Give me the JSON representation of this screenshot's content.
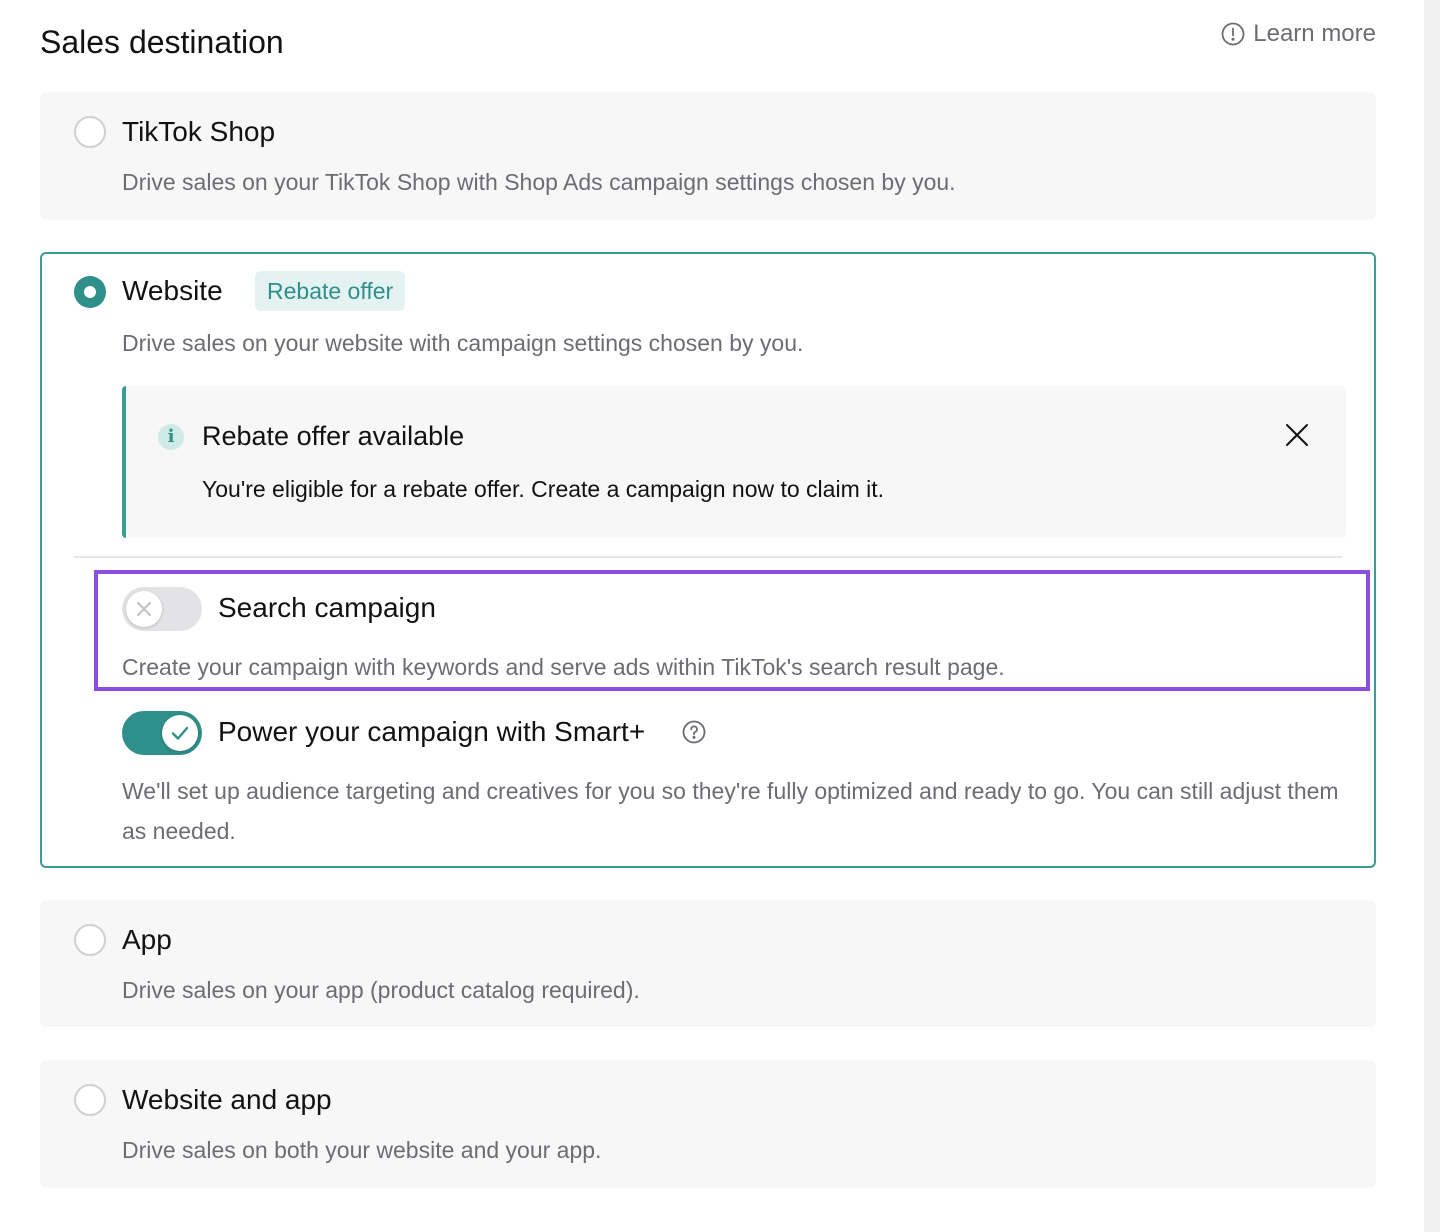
{
  "header": {
    "title": "Sales destination",
    "learn_more": "Learn more"
  },
  "options": [
    {
      "title": "TikTok Shop",
      "description": "Drive sales on your TikTok Shop with Shop Ads campaign settings chosen by you.",
      "selected": false
    },
    {
      "title": "Website",
      "badge": "Rebate offer",
      "description": "Drive sales on your website with campaign settings chosen by you.",
      "selected": true,
      "notice": {
        "title": "Rebate offer available",
        "body": "You're eligible for a rebate offer. Create a campaign now to claim it."
      },
      "search_campaign": {
        "title": "Search campaign",
        "description": "Create your campaign with keywords and serve ads within TikTok's search result page.",
        "enabled": false
      },
      "smart_plus": {
        "title": "Power your campaign with Smart+",
        "description": "We'll set up audience targeting and creatives for you so they're fully optimized and ready to go. You can still adjust them as needed.",
        "enabled": true
      }
    },
    {
      "title": "App",
      "description": "Drive sales on your app (product catalog required).",
      "selected": false
    },
    {
      "title": "Website and app",
      "description": "Drive sales on both your website and your app.",
      "selected": false
    }
  ],
  "colors": {
    "accent": "#2f8f8b",
    "highlight": "#8a4fe0",
    "badge_bg": "#e4f3f1"
  }
}
